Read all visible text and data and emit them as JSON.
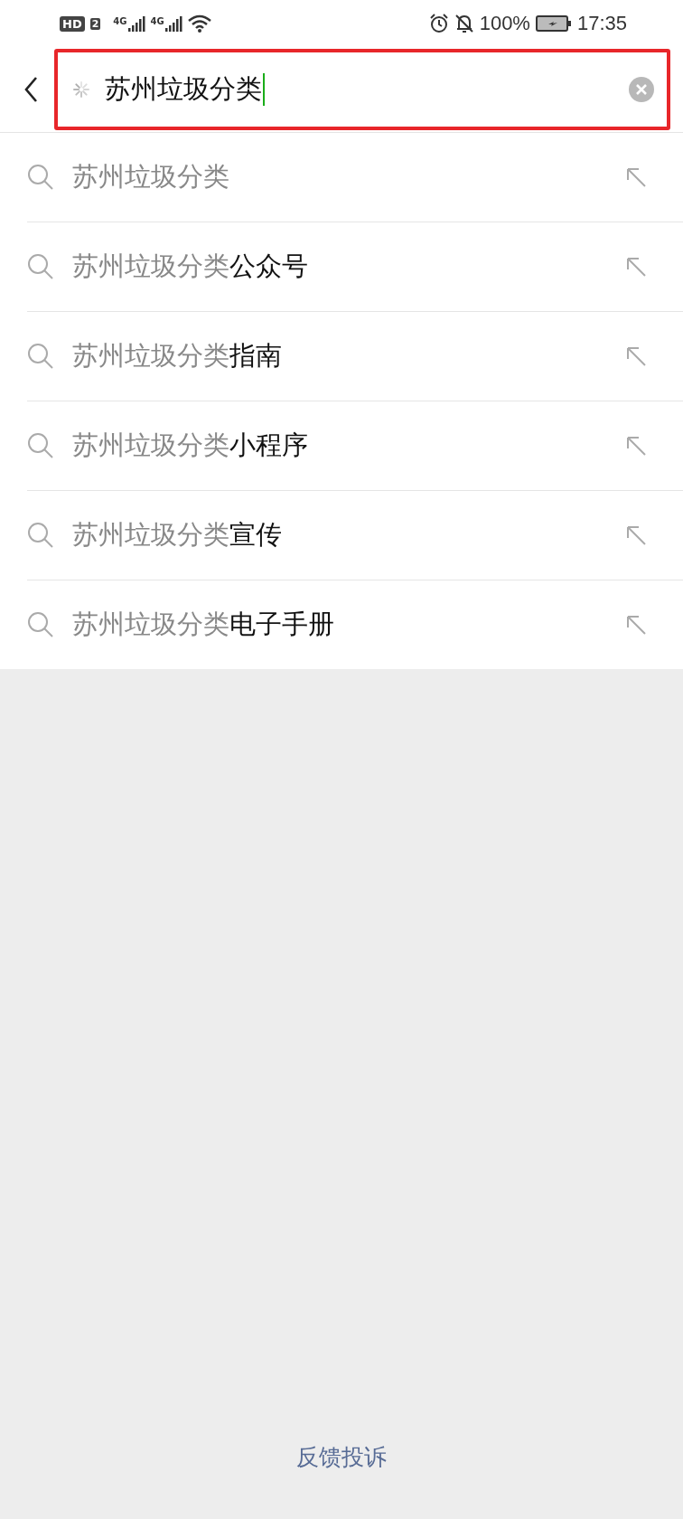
{
  "status_bar": {
    "hd_badge": "HD",
    "sim_slot": "2",
    "networks": [
      "4G",
      "4G"
    ],
    "battery_percent": "100%",
    "time": "17:35"
  },
  "search": {
    "value": "苏州垃圾分类",
    "highlighted": true
  },
  "suggestions": [
    {
      "prefix": "苏州垃圾分类"
    },
    {
      "prefix": "苏州垃圾分类",
      "suffix": "公众号"
    },
    {
      "prefix": "苏州垃圾分类",
      "suffix": "指南"
    },
    {
      "prefix": "苏州垃圾分类",
      "suffix": "小程序"
    },
    {
      "prefix": "苏州垃圾分类",
      "suffix": "宣传"
    },
    {
      "prefix": "苏州垃圾分类",
      "suffix": "电子手册"
    }
  ],
  "footer_link": "反馈投诉"
}
